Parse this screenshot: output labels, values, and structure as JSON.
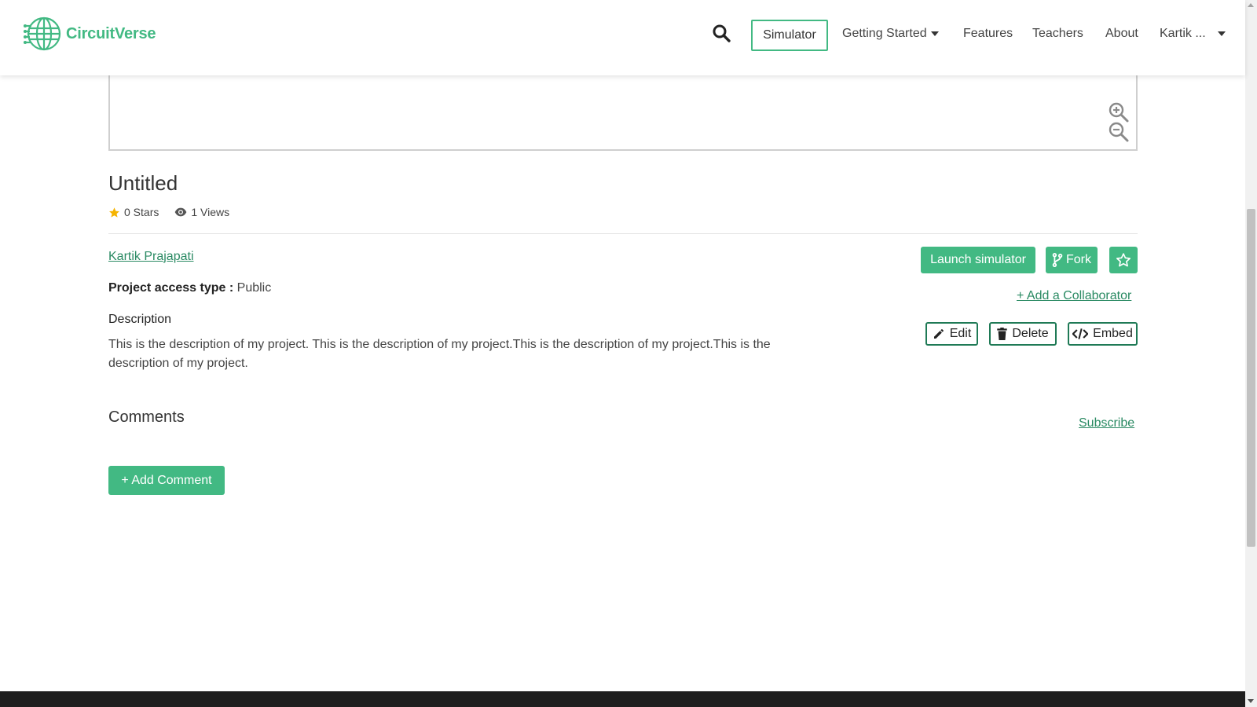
{
  "nav": {
    "brand": "CircuitVerse",
    "simulator": "Simulator",
    "getting_started": "Getting Started",
    "features": "Features",
    "teachers": "Teachers",
    "about": "About",
    "user": "Kartik ..."
  },
  "project": {
    "title": "Untitled",
    "stars": "0 Stars",
    "views": "1 Views",
    "author": "Kartik Prajapati",
    "access_label": "Project access type :",
    "access_value": "Public",
    "description_label": "Description",
    "description": "This is the description of my project. This is the description of my project.This is the description of my project.This is the description of my project."
  },
  "actions": {
    "launch": "Launch simulator",
    "fork": "Fork",
    "add_collaborator": "+ Add a Collaborator",
    "edit": "Edit",
    "delete": "Delete",
    "embed": "Embed"
  },
  "comments": {
    "heading": "Comments",
    "subscribe": "Subscribe",
    "add_comment": "+ Add Comment"
  },
  "colors": {
    "brand": "#42b983",
    "link": "#2a8a63",
    "star": "#f5b400"
  }
}
